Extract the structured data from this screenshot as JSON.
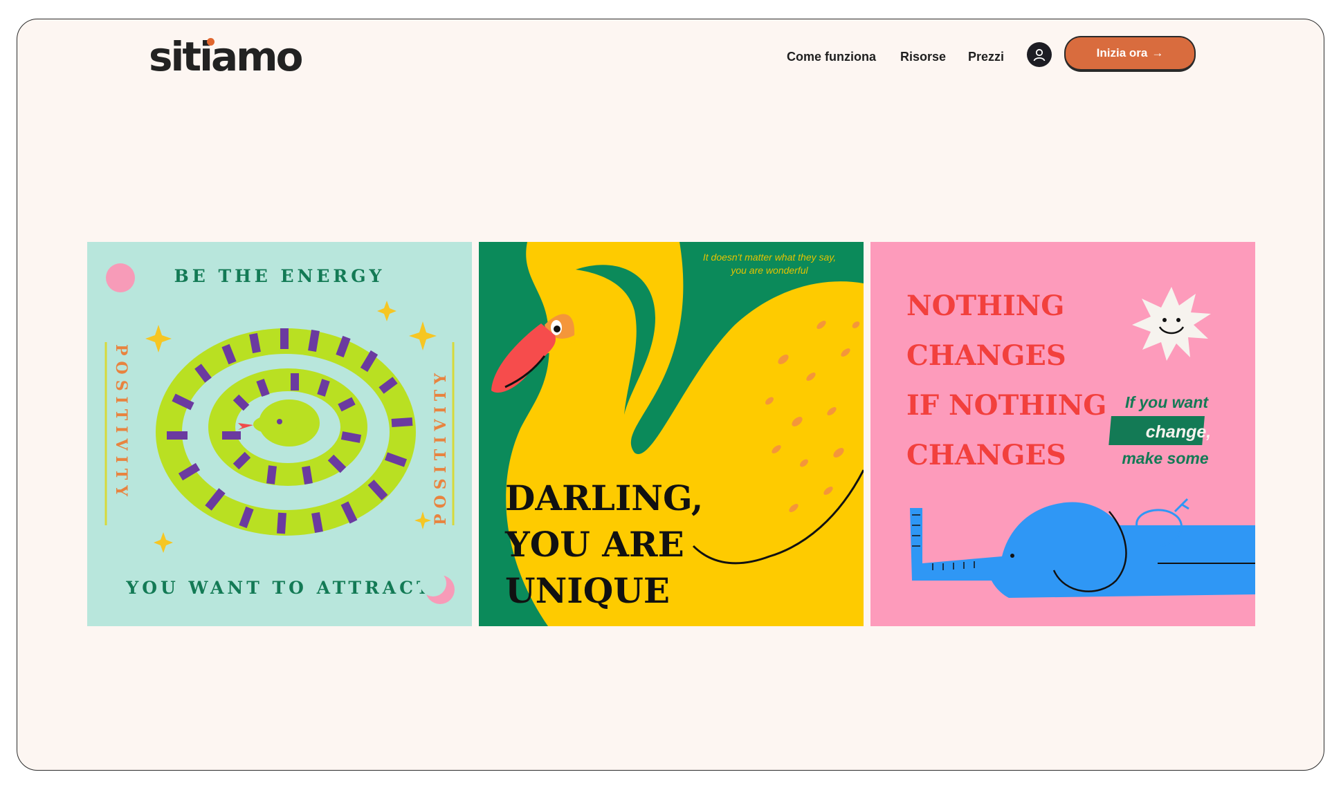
{
  "brand": {
    "logo_text": "sitiamo",
    "accent": "#e0662e"
  },
  "nav": {
    "items": [
      {
        "label": "Come funziona"
      },
      {
        "label": "Risorse"
      },
      {
        "label": "Prezzi"
      }
    ],
    "user_icon": "user-icon",
    "cta_label": "Inizia ora",
    "cta_arrow": "→"
  },
  "cards": [
    {
      "top_text": "BE THE ENERGY",
      "bottom_text": "YOU WANT TO ATTRACT",
      "side_text": "POSITIVITY",
      "bg": "#b8e6dc"
    },
    {
      "small_line1": "It doesn't matter what they say,",
      "small_line2": "you are wonderful",
      "big_line1": "DARLING,",
      "big_line2": "YOU ARE",
      "big_line3": "UNIQUE",
      "bg": "#0b8a5a"
    },
    {
      "line1": "NOTHING",
      "line2": "CHANGES",
      "line3": "IF NOTHING",
      "line4": "CHANGES",
      "aside1": "If you want",
      "aside2": "change,",
      "aside3": "make some",
      "bg": "#fd9bbb"
    }
  ]
}
